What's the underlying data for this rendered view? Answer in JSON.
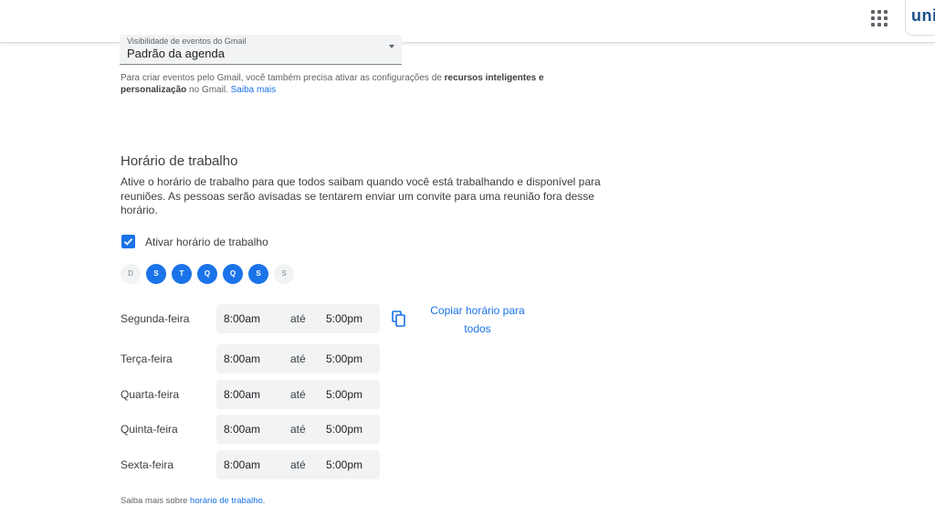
{
  "header": {
    "brand_text": "uni"
  },
  "event_default": {
    "label": "Visibilidade de eventos do Gmail",
    "value": "Padrão da agenda"
  },
  "gmail_note": {
    "text_before": "Para criar eventos pelo Gmail, você também precisa ativar as configurações de ",
    "bold": "recursos inteligentes e personalização",
    "text_after": " no Gmail. ",
    "link": "Saiba mais"
  },
  "working_hours": {
    "title": "Horário de trabalho",
    "description": "Ative o horário de trabalho para que todos saibam quando você está trabalhando e disponível para reuniões. As pessoas serão avisadas se tentarem enviar um convite para uma reunião fora desse horário.",
    "checkbox_label": "Ativar horário de trabalho",
    "checkbox_checked": true,
    "days": [
      {
        "letter": "D",
        "active": false
      },
      {
        "letter": "S",
        "active": true
      },
      {
        "letter": "T",
        "active": true
      },
      {
        "letter": "Q",
        "active": true
      },
      {
        "letter": "Q",
        "active": true
      },
      {
        "letter": "S",
        "active": true
      },
      {
        "letter": "S",
        "active": false
      }
    ],
    "separator": "até",
    "rows": [
      {
        "day": "Segunda-feira",
        "start": "8:00am",
        "end": "5:00pm"
      },
      {
        "day": "Terça-feira",
        "start": "8:00am",
        "end": "5:00pm"
      },
      {
        "day": "Quarta-feira",
        "start": "8:00am",
        "end": "5:00pm"
      },
      {
        "day": "Quinta-feira",
        "start": "8:00am",
        "end": "5:00pm"
      },
      {
        "day": "Sexta-feira",
        "start": "8:00am",
        "end": "5:00pm"
      }
    ],
    "copy_label": "Copiar horário para todos",
    "footer_text": "Saiba mais sobre ",
    "footer_link": "horário de trabalho",
    "footer_end": "."
  },
  "colors": {
    "accent": "#1a73e8",
    "text": "#3c4043",
    "muted": "#5f6368",
    "field_bg": "#f1f3f4"
  },
  "icons": {
    "apps": "apps-grid-icon",
    "copy": "copy-icon",
    "check": "check-icon",
    "dropdown": "dropdown-arrow-icon"
  }
}
